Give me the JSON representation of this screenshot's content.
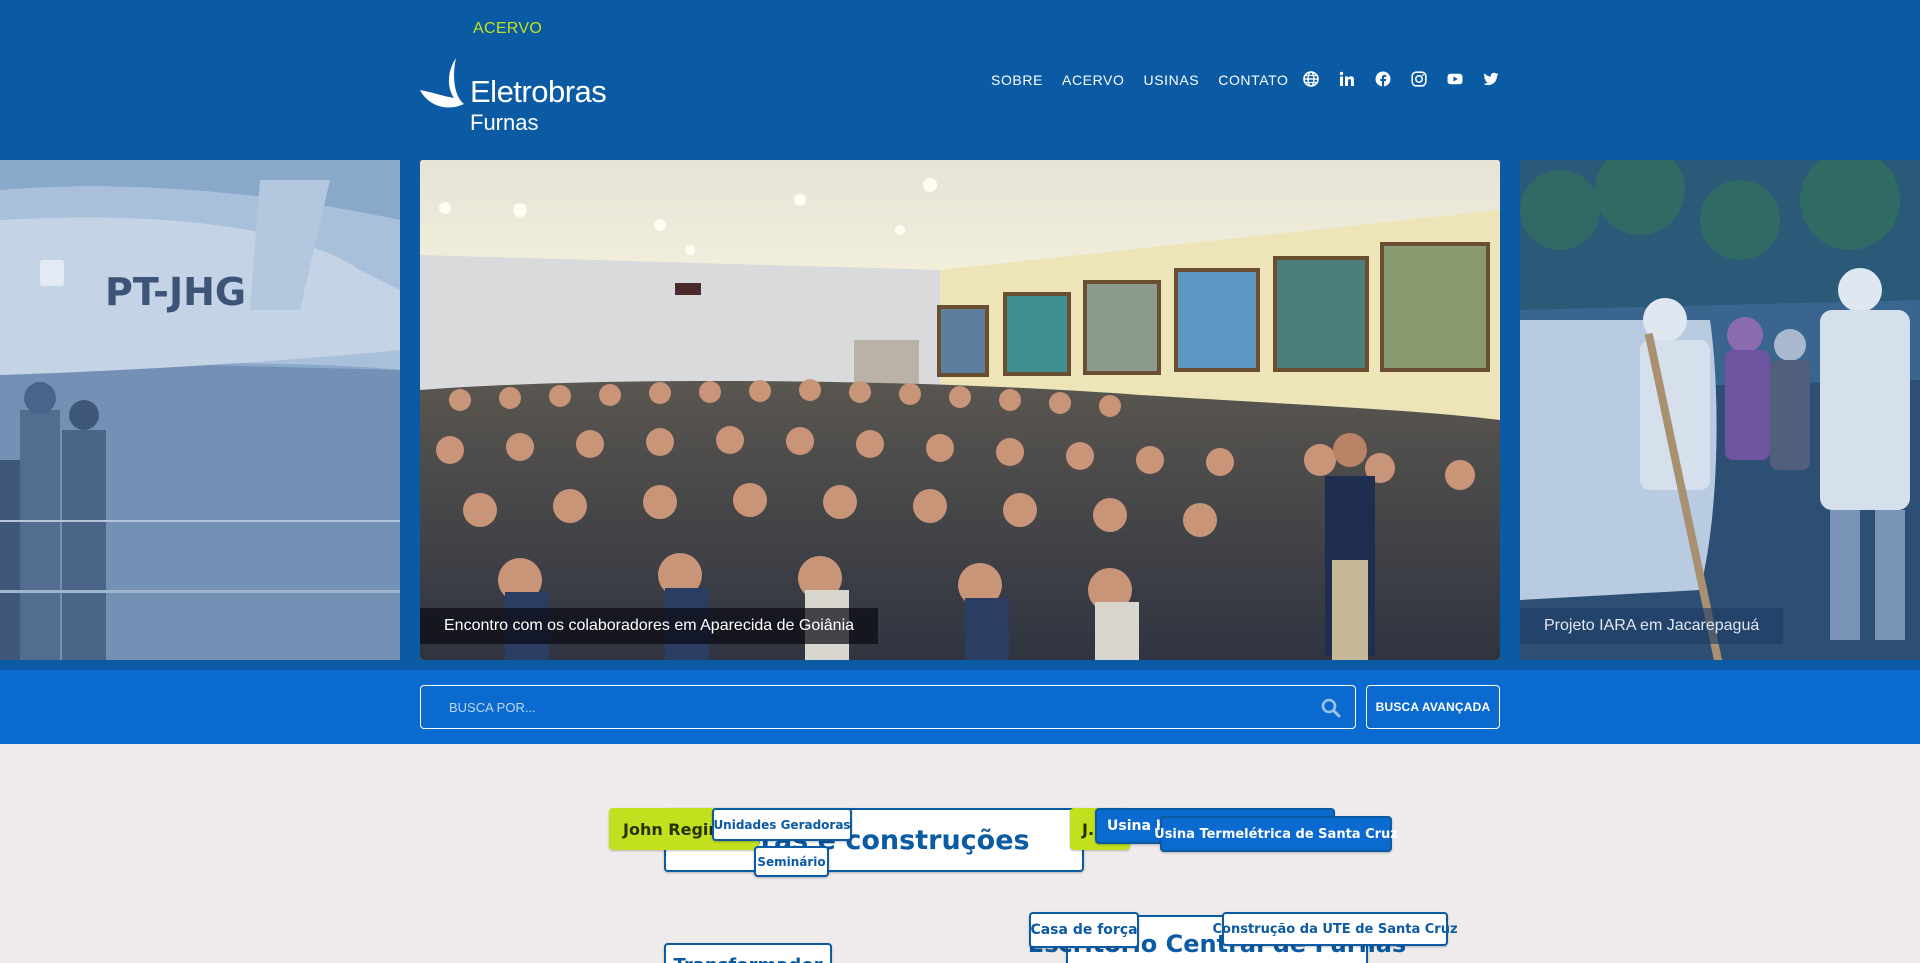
{
  "header": {
    "kicker": "ACERVO",
    "logo_line1": "Eletrobras",
    "logo_line2": "Furnas",
    "nav": [
      "SOBRE",
      "ACERVO",
      "USINAS",
      "CONTATO"
    ],
    "social_icons": [
      "globe-icon",
      "linkedin-icon",
      "facebook-icon",
      "instagram-icon",
      "youtube-icon",
      "twitter-icon"
    ]
  },
  "carousel": {
    "main_caption": "Encontro com os colaboradores em Aparecida de Goiânia",
    "right_caption": "Projeto IARA em Jacarepaguá",
    "left_plane_label": "PT-JHG"
  },
  "search": {
    "placeholder": "BUSCA POR...",
    "advanced_label": "BUSCA AVANÇADA"
  },
  "tags": {
    "john_regina": "John Regina",
    "unidades": "Unidades Geradoras",
    "obras": "Obras e construções",
    "seminario": "Seminário",
    "lime_j": "J.",
    "usina_hi": "Usina Hi",
    "ute_santa_cruz": "Usina Termelétrica de Santa Cruz",
    "casa_forca": "Casa de força",
    "construcao_ute": "Construção da UTE de Santa Cruz",
    "escritorio": "Escritório Central de Furnas",
    "bottom_left": "Transformador"
  },
  "colors": {
    "brand_blue": "#0a5aa4",
    "search_blue": "#0b6ad0",
    "accent_lime": "#c3e01f",
    "page_bg": "#efebeb"
  }
}
